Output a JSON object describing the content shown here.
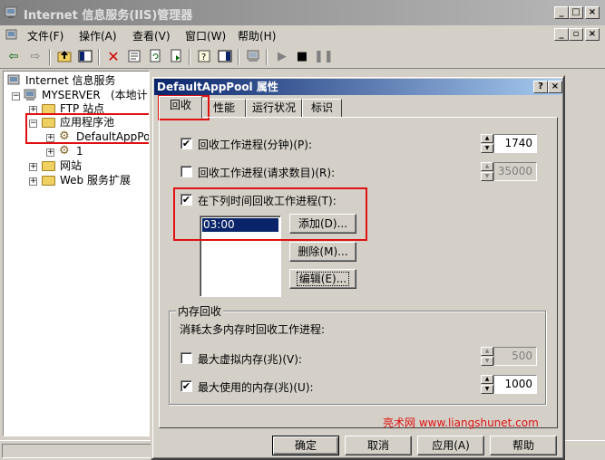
{
  "window": {
    "title": "Internet 信息服务(IIS)管理器",
    "controls": {
      "minimize": "_",
      "maximize": "□",
      "close": "×"
    },
    "menu": [
      "文件(F)",
      "操作(A)",
      "查看(V)",
      "窗口(W)",
      "帮助(H)"
    ],
    "inner_controls": {
      "minimize": "_",
      "restore": "▫",
      "close": "×"
    }
  },
  "tree": {
    "root": "Internet 信息服务",
    "server": "MYSERVER",
    "server_suffix": "(本地计",
    "items": [
      "FTP 站点",
      "应用程序池",
      "DefaultAppPoo",
      "1",
      "网站",
      "Web 服务扩展"
    ]
  },
  "dialog": {
    "title": "DefaultAppPool 属性",
    "help": "?",
    "close": "×",
    "tabs": [
      "回收",
      "性能",
      "运行状况",
      "标识"
    ],
    "active_tab": "回收",
    "recycle_minutes": {
      "label": "回收工作进程(分钟)(P):",
      "checked": true,
      "value": "1740"
    },
    "recycle_requests": {
      "label": "回收工作进程(请求数目)(R):",
      "checked": false,
      "value": "35000"
    },
    "recycle_times": {
      "label": "在下列时间回收工作进程(T):",
      "checked": true,
      "times": [
        "03:00"
      ],
      "add": "添加(D)...",
      "remove": "删除(M)...",
      "edit": "编辑(E)..."
    },
    "memory": {
      "group_title": "内存回收",
      "description": "消耗太多内存时回收工作进程:",
      "virtual": {
        "label": "最大虚拟内存(兆)(V):",
        "checked": false,
        "value": "500"
      },
      "used": {
        "label": "最大使用的内存(兆)(U):",
        "checked": true,
        "value": "1000"
      }
    },
    "buttons": {
      "ok": "确定",
      "cancel": "取消",
      "apply": "应用(A)",
      "help": "帮助"
    }
  },
  "watermark": "亮术网 www.liangshunet.com",
  "colors": {
    "highlight": "#e01010",
    "selection": "#0a246a"
  }
}
